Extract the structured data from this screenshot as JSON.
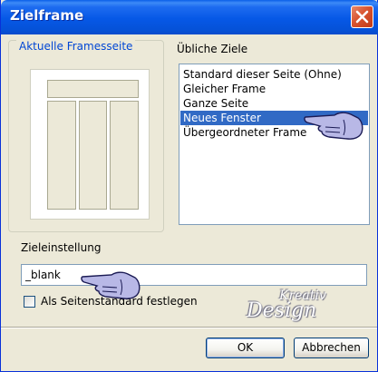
{
  "window": {
    "title": "Zielframe"
  },
  "group": {
    "legend": "Aktuelle Framesseite"
  },
  "list": {
    "label": "Übliche Ziele",
    "items": [
      {
        "label": "Standard dieser Seite (Ohne)",
        "selected": false
      },
      {
        "label": "Gleicher Frame",
        "selected": false
      },
      {
        "label": "Ganze Seite",
        "selected": false
      },
      {
        "label": "Neues Fenster",
        "selected": true
      },
      {
        "label": "Übergeordneter Frame",
        "selected": false
      }
    ]
  },
  "target": {
    "label": "Zieleinstellung",
    "value": "_blank"
  },
  "checkbox": {
    "label": "Als Seitenstandard festlegen",
    "checked": false
  },
  "buttons": {
    "ok": "OK",
    "cancel": "Abbrechen"
  },
  "watermark": {
    "line1": "Kreativ",
    "line2": "Design"
  },
  "icons": {
    "close": "close-icon",
    "hand": "pointing-hand-icon"
  },
  "colors": {
    "selection": "#316ac5",
    "legend": "#0046d5",
    "titlebar": "#0658e6"
  }
}
